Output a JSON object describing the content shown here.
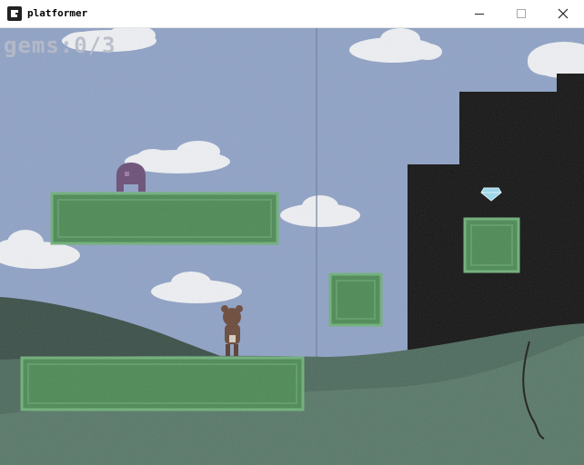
{
  "window": {
    "title": "platformer",
    "icons": {
      "app": "godot-icon",
      "minimize": "minimize-icon",
      "maximize": "maximize-icon",
      "close": "close-icon"
    }
  },
  "hud": {
    "gems_text": "gems:0/3"
  },
  "colors": {
    "sky": "#8fa2c6",
    "cloud": "#eef0f3",
    "platform": "#4d8a55",
    "platform_border": "#6fb07a",
    "hill_dark": "#3a4f47",
    "hill_mid": "#4d6a5d",
    "hill_front": "#587868",
    "tower": "#141414",
    "gem": "#9bd8ec",
    "player": "#6b4a3a",
    "enemy": "#6c4f78"
  }
}
